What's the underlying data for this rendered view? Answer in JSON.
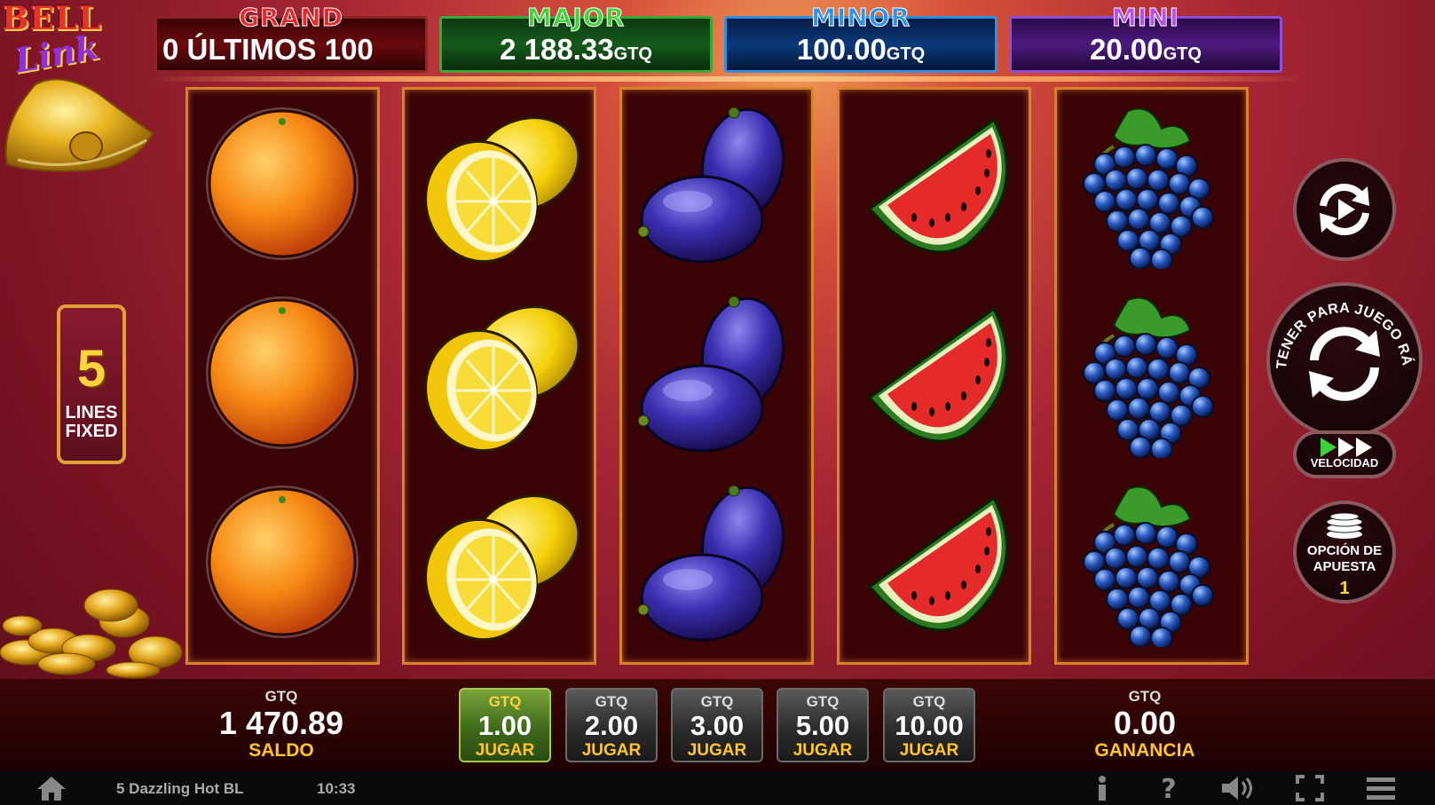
{
  "game": {
    "logo_text": [
      "BELL",
      "Link"
    ]
  },
  "jackpots": [
    {
      "name": "GRAND",
      "value": "0 ÚLTIMOS 100",
      "currency": ""
    },
    {
      "name": "MAJOR",
      "value": "2 188.33",
      "currency": "GTQ"
    },
    {
      "name": "MINOR",
      "value": "100.00",
      "currency": "GTQ"
    },
    {
      "name": "MINI",
      "value": "20.00",
      "currency": "GTQ"
    }
  ],
  "reels": [
    [
      "orange",
      "orange",
      "orange"
    ],
    [
      "lemon",
      "lemon",
      "lemon"
    ],
    [
      "plum",
      "plum",
      "plum"
    ],
    [
      "watermelon",
      "watermelon",
      "watermelon"
    ],
    [
      "grapes",
      "grapes",
      "grapes"
    ]
  ],
  "lines_badge": {
    "number": "5",
    "line1": "LINES",
    "line2": "FIXED"
  },
  "buttons": {
    "autoplay_icon": "autoplay-icon",
    "spin_curved_text": "MANTENER PARA JUEGO RÁPIDO",
    "speed_label": "VELOCIDAD",
    "bet_option_label_1": "OPCIÓN DE",
    "bet_option_label_2": "APUESTA",
    "bet_option_value": "1"
  },
  "balance": {
    "currency": "GTQ",
    "amount": "1 470.89",
    "label": "SALDO"
  },
  "bets": [
    {
      "currency": "GTQ",
      "value": "1.00",
      "label": "JUGAR",
      "active": true
    },
    {
      "currency": "GTQ",
      "value": "2.00",
      "label": "JUGAR",
      "active": false
    },
    {
      "currency": "GTQ",
      "value": "3.00",
      "label": "JUGAR",
      "active": false
    },
    {
      "currency": "GTQ",
      "value": "5.00",
      "label": "JUGAR",
      "active": false
    },
    {
      "currency": "GTQ",
      "value": "10.00",
      "label": "JUGAR",
      "active": false
    }
  ],
  "win": {
    "currency": "GTQ",
    "amount": "0.00",
    "label": "GANANCIA"
  },
  "status_bar": {
    "game_name": "5 Dazzling Hot BL",
    "time": "10:33",
    "icons": [
      "home-icon",
      "info-icon",
      "help-icon",
      "sound-icon",
      "fullscreen-icon",
      "menu-icon"
    ]
  },
  "colors": {
    "grand": "#e22a2a",
    "major": "#44d23a",
    "minor": "#2f93ee",
    "mini": "#b64ef0",
    "accent_gold": "#ffc52a",
    "reel_border": "#d9822b",
    "active_bet": "#7aa43a"
  }
}
